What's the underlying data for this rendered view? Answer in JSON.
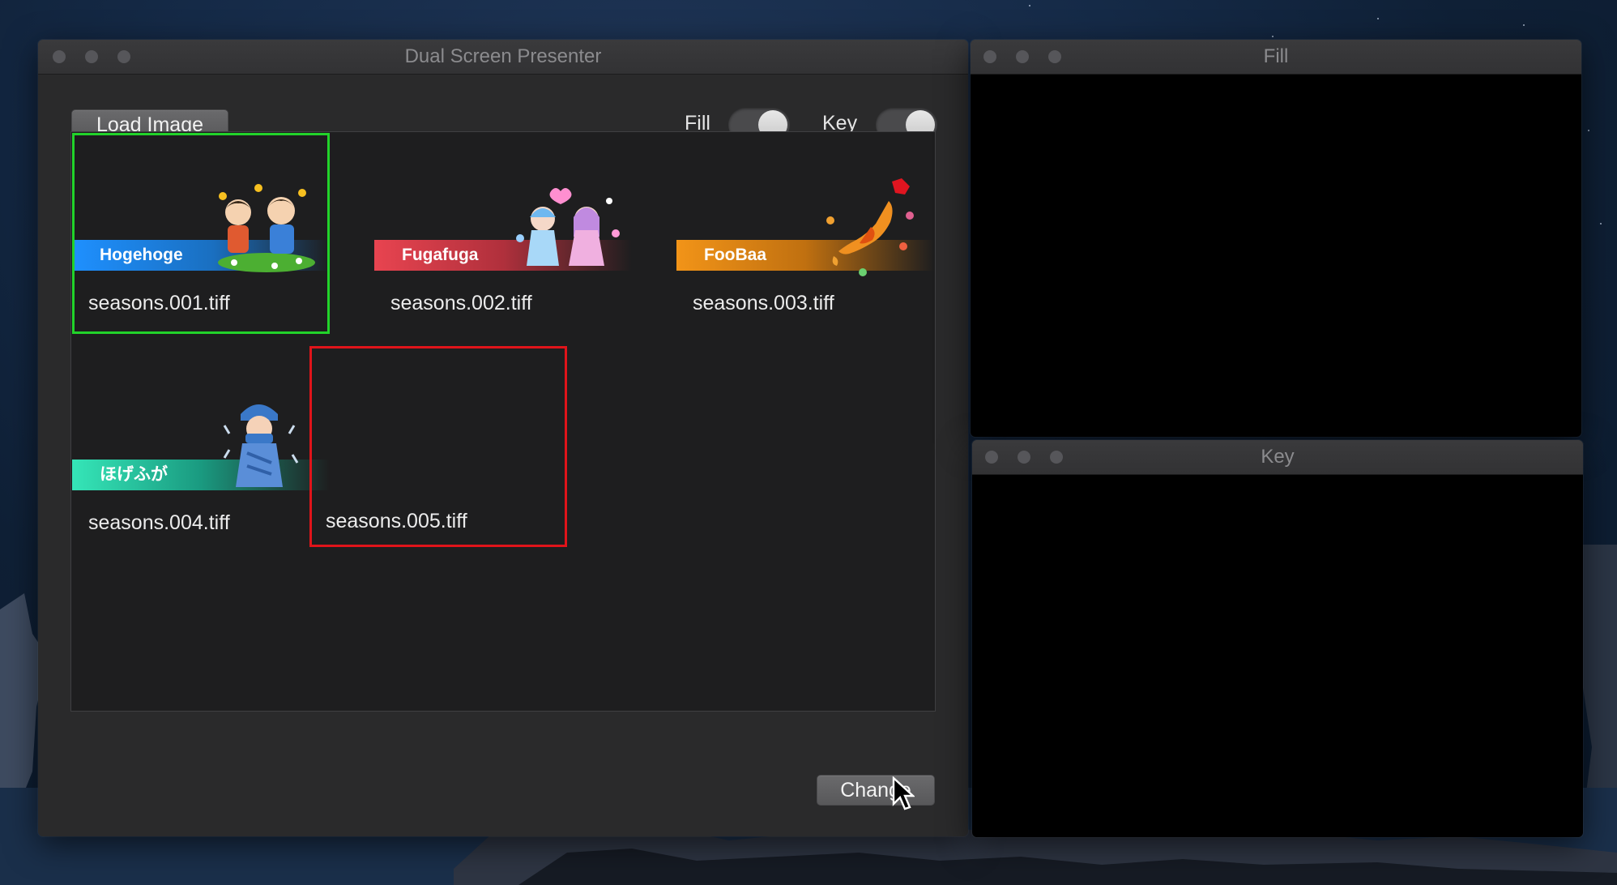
{
  "main_window": {
    "title": "Dual Screen Presenter",
    "load_button": "Load Image",
    "fill_label": "Fill",
    "key_label": "Key",
    "change_button": "Change",
    "fill_toggle_on": true,
    "key_toggle_on": true
  },
  "images": [
    {
      "file": "seasons.001.tiff",
      "banner": "Hogehoge",
      "state": "selected-green"
    },
    {
      "file": "seasons.002.tiff",
      "banner": "Fugafuga",
      "state": ""
    },
    {
      "file": "seasons.003.tiff",
      "banner": "FooBaa",
      "state": ""
    },
    {
      "file": "seasons.004.tiff",
      "banner": "ほげふが",
      "state": ""
    },
    {
      "file": "seasons.005.tiff",
      "banner": "",
      "state": "selected-red"
    }
  ],
  "fill_window": {
    "title": "Fill"
  },
  "key_window": {
    "title": "Key"
  },
  "colors": {
    "green_selection": "#22d32a",
    "red_selection": "#e0141a",
    "banner_blue": "#2a8ee6",
    "banner_red": "#e0404a",
    "banner_orange": "#f0901a",
    "banner_teal": "#30e0b0"
  }
}
